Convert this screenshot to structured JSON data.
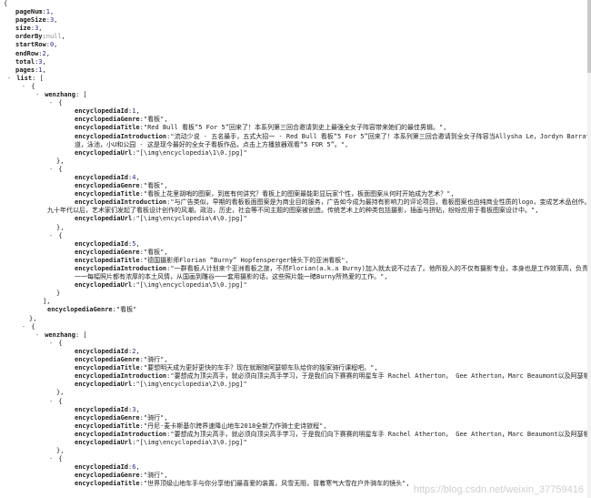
{
  "meta": {
    "pageNum": "1",
    "pageSize": "3",
    "size": "3",
    "orderBy": "null",
    "startRow": "0",
    "endRow": "2",
    "total": "3",
    "pages": "1"
  },
  "list": [
    {
      "wenzhang": [
        {
          "encyclopediaId": "1",
          "encyclopediaGenre": "\"看板\"",
          "encyclopediaTitle": "\"Red  Bull  看板“5  For  5”回来了！本系列第三回合邀请到史上最强全女子阵容带来她们的最佳男辑。\"",
          "encyclopediaIntroduction": "\"流动少说  -  五名最手，五式大招一  -  Red  Bull  看板“5  For  5”回来了！本系列第三回合邀请到全女子阵容当Allysha  Le，Jordyn  Barratt，",
          "encyclopediaIntroduction_cont": "道，泳池，小U和公园 -   这是现今最好的全女子看板作品，点击上方播放器观看“5  FOR  5”。\"",
          "encyclopediaUrl": "\"[\\img\\encyclopedia\\1\\0.jpg]\""
        },
        {
          "encyclopediaId": "4",
          "encyclopediaGenre": "\"看板\"",
          "encyclopediaTitle": "\"看板上花里胡哨的图案，到底有何讲究？看板上的图案最能彰显玩家个性，板面图案从何时开始成为艺术？\"",
          "encyclopediaIntroduction": "\"与广告类似，早期的看板板面图案是为商业目的服务，广告如今成为最持有影响力的评论项目，看板图案也由纯商业性质的logo，变成艺术品创作。早在",
          "encyclopediaIntroduction_cont": "九十年代以后，艺术家们发起了看板设计创作的风潮，政治，历史，社会等不同主题的图案被创造。传统艺术上的种类包括摄影，插画与拼贴，纷纷应用于看板图案设计中。\"",
          "encyclopediaUrl": "\"[\\img\\encyclopedia\\4\\0.jpg]\""
        },
        {
          "encyclopediaId": "5",
          "encyclopediaGenre": "\"看板\"",
          "encyclopediaTitle": "\"德国摄影师Florian  “Burny”  Hopfensperger镜头下的亚洲看板\"",
          "encyclopediaIntroduction": "\"一群看板人计划来个亚洲看板之旅，不然Florian(a.k.a  Burny)加入就太说不过去了。他所投入的不仅有摄影专业，本身也是工作效率高，负责几乎",
          "encyclopediaIntroduction_cont": "一一每幅照片都有浓厚的本土风情，从国画到雕谷一一套用摄影的话，这些照片能一睹Burny所热爱的工作。\"",
          "encyclopediaUrl": "\"[\\img\\encyclopedia\\5\\0.jpg]\""
        }
      ],
      "encyclopediaGenre": "\"看板\""
    },
    {
      "wenzhang": [
        {
          "encyclopediaId": "2",
          "encyclopediaGenre": "\"骑行\"",
          "encyclopediaTitle": "\"要想明天成为更好更快的车手？现在就跟随阿瑟顿车队给你的独家骑行课程吧。\"",
          "encyclopediaIntroduction": "\"要想成为顶尖高手，就必须向顶尖高手学习，于是我们向下赛赛的明星车手  Rachel  Atherton，  Gee  Atherton，Marc  Beaumont以及阿瑟顿车队其",
          "encyclopediaUrl": "\"[\\img\\encyclopedia\\2\\0.jpg]\""
        },
        {
          "encyclopediaId": "3",
          "encyclopediaGenre": "\"骑行\"",
          "encyclopediaTitle": "\"丹尼·麦卡斯基尔跨界速降山地车2018全新力作骑士史诗旅程\"",
          "encyclopediaIntroduction": "\"要想成为顶尖高手，就必须向顶尖高手学习，于是我们向下赛赛的明星车手  Rachel  Atherton，  Gee  Atherton，Marc  Beaumont以及阿瑟顿车队其",
          "encyclopediaUrl": "\"[\\img\\encyclopedia\\3\\0.jpg]\""
        },
        {
          "encyclopediaId": "6",
          "encyclopediaGenre": "\"骑行\"",
          "encyclopediaTitle": "\"世界顶级山地车手与你分享他们最喜爱的装置，风雪无阻，冒着寒气大雪在户外骑车的镜头\""
        }
      ]
    }
  ],
  "watermark": "https://blog.csdn.net/weixin_37759416"
}
